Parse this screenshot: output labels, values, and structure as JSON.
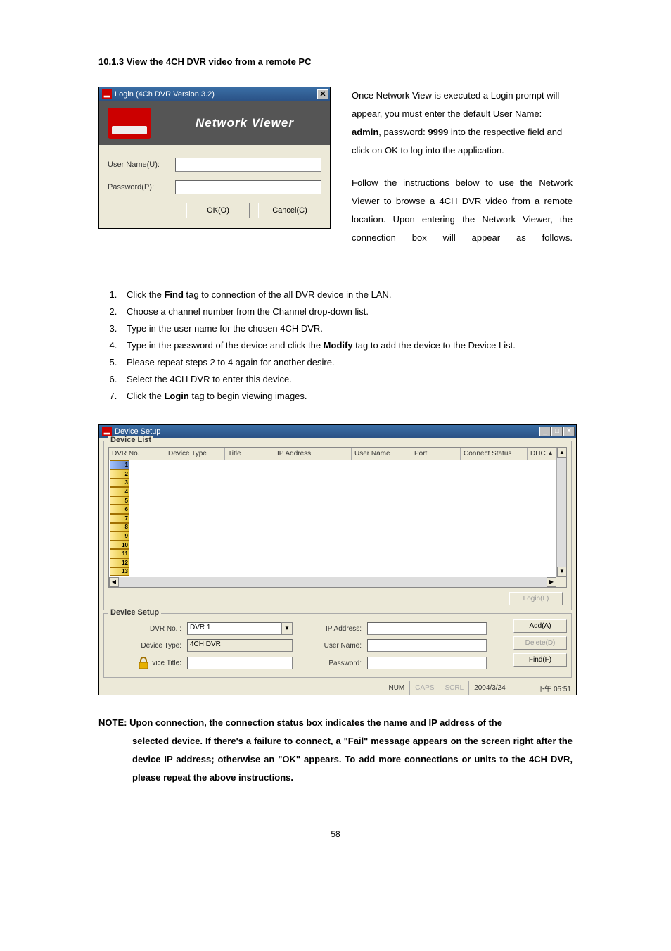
{
  "section_heading": "10.1.3   View the 4CH DVR video from a remote PC",
  "login_window": {
    "title": "Login (4Ch DVR Version 3.2)",
    "banner": "Network Viewer",
    "username_label": "User Name(U):",
    "password_label": "Password(P):",
    "ok_label": "OK(O)",
    "cancel_label": "Cancel(C)"
  },
  "intro_para_1_pre": "Once Network View is executed a Login prompt will appear, you must enter the default User Name: ",
  "intro_admin": "admin",
  "intro_mid1": ", password: ",
  "intro_pw": "9999",
  "intro_mid2": " into the respective field and click on OK to log into the application.",
  "intro_para_2": "Follow the instructions below to use the Network Viewer to browse a 4CH DVR video from a remote location. Upon entering the Network Viewer, the connection box will appear as follows.",
  "steps": {
    "s1a": "Click the ",
    "s1b": "Find",
    "s1c": " tag to connection of the all DVR device in the LAN.",
    "s2": "Choose a channel number from the Channel drop-down list.",
    "s3": "Type in the user name for the chosen 4CH DVR.",
    "s4a": "Type in the password of the device and click the ",
    "s4b": "Modify",
    "s4c": " tag to add the device to the Device List.",
    "s5": "Please repeat steps 2 to 4 again for another desire.",
    "s6": "Select the 4CH DVR to enter this device.",
    "s7a": "Click the ",
    "s7b": "Login",
    "s7c": " tag to begin viewing images."
  },
  "device_window": {
    "title": "Device Setup",
    "group_list": "Device List",
    "columns": [
      "DVR No.",
      "Device Type",
      "Title",
      "IP Address",
      "User Name",
      "Port",
      "Connect Status",
      "DHC"
    ],
    "group_setup": "Device Setup",
    "dvr_no_label": "DVR No. :",
    "dvr_no_value": "DVR 1",
    "device_type_label": "Device Type:",
    "device_type_value": "4CH DVR",
    "device_title_label": "vice Title:",
    "ip_label": "IP Address:",
    "user_label": "User Name:",
    "pw_label": "Password:",
    "btn_login": "Login(L)",
    "btn_add": "Add(A)",
    "btn_delete": "Delete(D)",
    "btn_find": "Find(F)",
    "status_num": "NUM",
    "status_caps": "CAPS",
    "status_scrl": "SCRL",
    "status_date": "2004/3/24",
    "status_time": "下午 05:51"
  },
  "note_label": "NOTE: ",
  "note_first": "Upon connection, the connection status box indicates the name and IP address of the",
  "note_rest": "selected device. If there's a failure to connect, a \"Fail\" message appears on the screen right after the device IP address; otherwise an \"OK\" appears. To add more connections or units to the 4CH DVR, please repeat the above instructions.",
  "page_number": "58"
}
